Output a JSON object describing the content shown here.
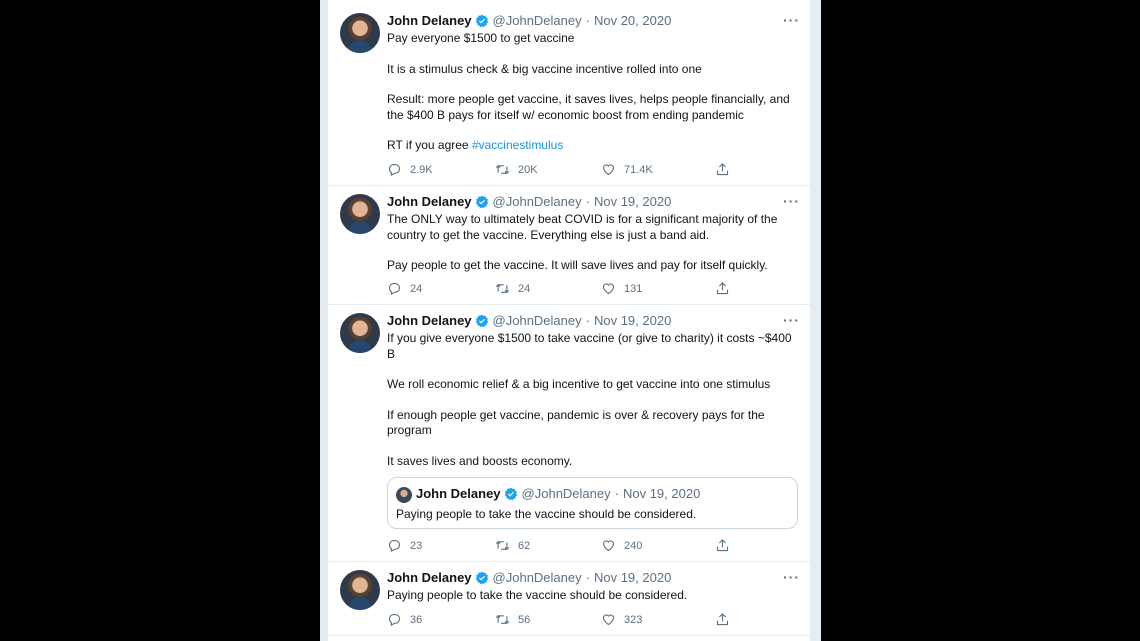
{
  "tweets": [
    {
      "name": "John Delaney",
      "handle": "@JohnDelaney",
      "date": "Nov 20, 2020",
      "paragraphs": [
        "Pay everyone $1500 to get vaccine",
        "It is a stimulus check & big vaccine incentive rolled into one",
        "Result: more people get vaccine, it saves lives, helps people financially, and the $400 B pays for itself w/ economic boost from ending pandemic",
        "RT if you agree"
      ],
      "hashtag": "#vaccinestimulus",
      "replies": "2.9K",
      "retweets": "20K",
      "likes": "71.4K"
    },
    {
      "name": "John Delaney",
      "handle": "@JohnDelaney",
      "date": "Nov 19, 2020",
      "paragraphs": [
        "The ONLY way to ultimately beat COVID is for a significant majority of the country to get the vaccine.  Everything else is just a band aid.",
        "Pay people to get the vaccine. It will save lives and pay for itself quickly."
      ],
      "replies": "24",
      "retweets": "24",
      "likes": "131"
    },
    {
      "name": "John Delaney",
      "handle": "@JohnDelaney",
      "date": "Nov 19, 2020",
      "paragraphs": [
        "If you give everyone $1500 to take vaccine (or give to charity) it costs ~$400 B",
        "We roll economic relief & a big incentive to get vaccine into one stimulus",
        "If enough people get vaccine, pandemic is over & recovery pays for the program",
        "It saves lives and boosts economy."
      ],
      "quote": {
        "name": "John Delaney",
        "handle": "@JohnDelaney",
        "date": "Nov 19, 2020",
        "text": "Paying people to take the vaccine should be considered."
      },
      "replies": "23",
      "retweets": "62",
      "likes": "240"
    },
    {
      "name": "John Delaney",
      "handle": "@JohnDelaney",
      "date": "Nov 19, 2020",
      "paragraphs": [
        "Paying people to take the vaccine should be considered."
      ],
      "replies": "36",
      "retweets": "56",
      "likes": "323"
    }
  ],
  "separator": "·",
  "more_label": "···",
  "colors": {
    "verified": "#1da1f2",
    "hashtag": "#1b95e0",
    "muted": "#5b7083"
  },
  "icons": [
    "verified-badge-icon",
    "more-icon",
    "reply-icon",
    "retweet-icon",
    "like-icon",
    "share-icon"
  ]
}
